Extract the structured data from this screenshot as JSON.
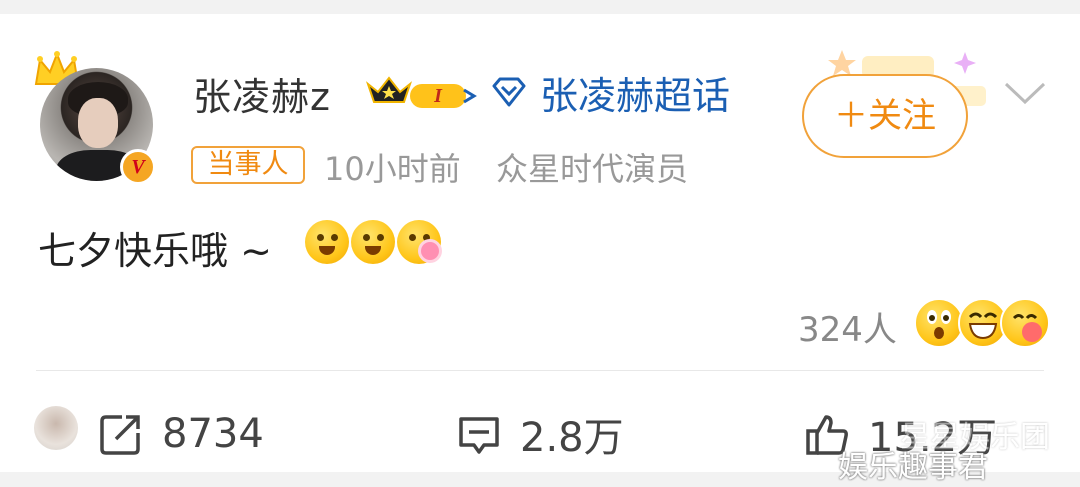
{
  "post": {
    "author": {
      "name": "张凌赫z",
      "vip_badge": "I",
      "verified_badge": "V"
    },
    "topic_link": "张凌赫超话",
    "follow_button": "＋关注",
    "tag": "当事人",
    "time": "10小时前",
    "source": "众星时代演员",
    "text": "七夕快乐哦 ~",
    "reactions": {
      "count": "324人"
    }
  },
  "actions": {
    "repost_count": "8734",
    "comment_count": "2.8万",
    "like_count": "15.2万"
  },
  "watermark": {
    "line1": "娱乐趣事君",
    "line2": "星星娱乐团"
  },
  "colors": {
    "accent_orange": "#f08a11",
    "topic_blue": "#1b5fb3",
    "text_gray": "#999999"
  }
}
